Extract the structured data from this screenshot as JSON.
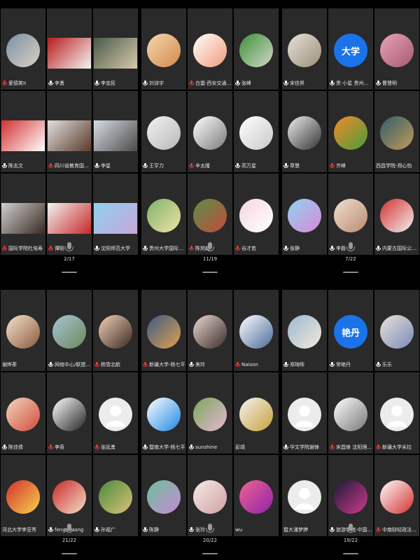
{
  "panels": [
    {
      "page_indicator": "2/17",
      "tiles": [
        {
          "name": "爱德笑II",
          "mic": "red",
          "kind": "avatar",
          "avatar": "photo-landscape"
        },
        {
          "name": "李勇",
          "mic": "white",
          "kind": "thumb",
          "thumb": "presentation-red"
        },
        {
          "name": "李忠民",
          "mic": "white",
          "kind": "thumb",
          "thumb": "video-office"
        },
        {
          "name": "陈志文",
          "mic": "white",
          "kind": "thumb",
          "thumb": "presentation-slide"
        },
        {
          "name": "四川省教育国际...",
          "mic": "red",
          "kind": "thumb",
          "thumb": "video-meeting"
        },
        {
          "name": "李星",
          "mic": "white",
          "kind": "thumb",
          "thumb": "video-person"
        },
        {
          "name": "国际学院杜培寿",
          "mic": "red",
          "kind": "thumb",
          "thumb": "video-person-glasses"
        },
        {
          "name": "谭刚",
          "mic": "red",
          "kind": "thumb",
          "thumb": "video-person-red"
        },
        {
          "name": "沈阳师范大学",
          "mic": "white",
          "kind": "thumb",
          "thumb": "video-campus"
        }
      ]
    },
    {
      "page_indicator": "11/19",
      "tiles": [
        {
          "name": "刘诗宇",
          "mic": "white",
          "kind": "avatar",
          "avatar": "anime-girl"
        },
        {
          "name": "白震-西安交通...",
          "mic": "red",
          "kind": "avatar",
          "avatar": "cartoon-cat"
        },
        {
          "name": "张峰",
          "mic": "white",
          "kind": "avatar",
          "avatar": "football-field"
        },
        {
          "name": "王亨力",
          "mic": "white",
          "kind": "avatar",
          "avatar": "anime-sketch"
        },
        {
          "name": "辛太隆",
          "mic": "red",
          "kind": "avatar",
          "avatar": "cartoon-dog"
        },
        {
          "name": "高万星",
          "mic": "white",
          "kind": "avatar",
          "avatar": "white-cat"
        },
        {
          "name": "贵州大学国际教...",
          "mic": "white",
          "kind": "avatar",
          "avatar": "anime-boy"
        },
        {
          "name": "陈旭超",
          "mic": "red",
          "kind": "avatar",
          "avatar": "city-square"
        },
        {
          "name": "谷才若",
          "mic": "red",
          "kind": "avatar",
          "avatar": "pink-person"
        }
      ]
    },
    {
      "page_indicator": "7/22",
      "tiles": [
        {
          "name": "宋佳昇",
          "mic": "white",
          "kind": "avatar",
          "avatar": "rabbit"
        },
        {
          "name": "贵·小星 贵州财经大...",
          "mic": "white",
          "kind": "text",
          "text": "大学"
        },
        {
          "name": "曹慧明",
          "mic": "white",
          "kind": "avatar",
          "avatar": "pink-flowers"
        },
        {
          "name": "章慧",
          "mic": "white",
          "kind": "avatar",
          "avatar": "woman-sketch"
        },
        {
          "name": "齐峰",
          "mic": "red",
          "kind": "avatar",
          "avatar": "broccoli"
        },
        {
          "name": "西昌学院-郑心怡",
          "mic": "none",
          "kind": "avatar",
          "avatar": "sunset"
        },
        {
          "name": "张静",
          "mic": "white",
          "kind": "avatar",
          "avatar": "anime-blue"
        },
        {
          "name": "李磊",
          "mic": "white",
          "kind": "avatar",
          "avatar": "baby"
        },
        {
          "name": "内蒙古国际公共关...",
          "mic": "white",
          "kind": "avatar",
          "avatar": "apple"
        }
      ]
    },
    {
      "page_indicator": "21/22",
      "tiles": [
        {
          "name": "谢烨荼",
          "mic": "none",
          "kind": "avatar",
          "avatar": "cartoon-kid"
        },
        {
          "name": "网络中心/联盟秘...",
          "mic": "white",
          "kind": "avatar",
          "avatar": "road"
        },
        {
          "name": "杨雪北航",
          "mic": "red",
          "kind": "avatar",
          "avatar": "memoji-girl"
        },
        {
          "name": "陈佳倩",
          "mic": "white",
          "kind": "avatar",
          "avatar": "memoji-woman"
        },
        {
          "name": "李奇",
          "mic": "red",
          "kind": "avatar",
          "avatar": "man-suit"
        },
        {
          "name": "张延勇",
          "mic": "red",
          "kind": "avatar",
          "avatar": "default"
        },
        {
          "name": "河北大学李亚秀",
          "mic": "none",
          "kind": "avatar",
          "avatar": "red-toy"
        },
        {
          "name": "fengshuang",
          "mic": "white",
          "kind": "avatar",
          "avatar": "girl-red"
        },
        {
          "name": "孙福广",
          "mic": "white",
          "kind": "avatar",
          "avatar": "green-park"
        }
      ]
    },
    {
      "page_indicator": "20/22",
      "tiles": [
        {
          "name": "新疆大学-杨七平",
          "mic": "red",
          "kind": "avatar",
          "avatar": "sunset-field"
        },
        {
          "name": "美玲",
          "mic": "white",
          "kind": "avatar",
          "avatar": "woman-portrait"
        },
        {
          "name": "Naison",
          "mic": "red",
          "kind": "avatar",
          "avatar": "bird"
        },
        {
          "name": "暨南大学-杨七平",
          "mic": "white",
          "kind": "avatar",
          "avatar": "blue-logo"
        },
        {
          "name": "sunshine",
          "mic": "white",
          "kind": "avatar",
          "avatar": "flower-green"
        },
        {
          "name": "彭靖",
          "mic": "none",
          "kind": "avatar",
          "avatar": "medals"
        },
        {
          "name": "陈静",
          "mic": "white",
          "kind": "avatar",
          "avatar": "anime-fairy"
        },
        {
          "name": "张玲",
          "mic": "white",
          "kind": "avatar",
          "avatar": "baby-sleep"
        },
        {
          "name": "wu",
          "mic": "none",
          "kind": "avatar",
          "avatar": "pink-rose"
        }
      ]
    },
    {
      "page_indicator": "19/22",
      "tiles": [
        {
          "name": "郑琦晖",
          "mic": "white",
          "kind": "avatar",
          "avatar": "tower"
        },
        {
          "name": "常艳丹",
          "mic": "white",
          "kind": "text",
          "text": "艳丹"
        },
        {
          "name": "乐乐",
          "mic": "white",
          "kind": "avatar",
          "avatar": "baby-bed"
        },
        {
          "name": "华文学院谢锋",
          "mic": "white",
          "kind": "avatar",
          "avatar": "default"
        },
        {
          "name": "宋昌锋 沈阳理...",
          "mic": "red",
          "kind": "avatar",
          "avatar": "ink-painting"
        },
        {
          "name": "新疆大学米拉",
          "mic": "red",
          "kind": "avatar",
          "avatar": "default"
        },
        {
          "name": "暨大潘梦婷",
          "mic": "none",
          "kind": "avatar",
          "avatar": "default"
        },
        {
          "name": "旅游学院-中国石...",
          "mic": "white",
          "kind": "avatar",
          "avatar": "anime-dark"
        },
        {
          "name": "中南财经政法大...",
          "mic": "red",
          "kind": "avatar",
          "avatar": "red-logo"
        }
      ]
    }
  ]
}
